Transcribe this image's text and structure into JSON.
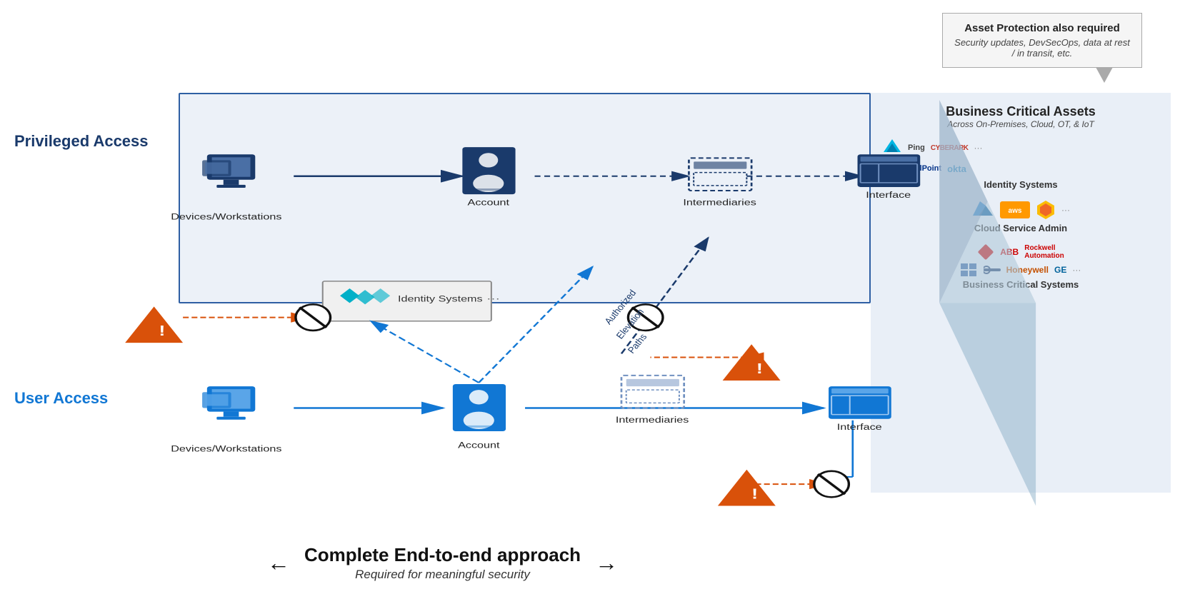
{
  "callout": {
    "title": "Asset Protection also required",
    "body": "Security updates, DevSecOps, data at rest / in transit, etc."
  },
  "labels": {
    "privileged_access": "Privileged Access",
    "user_access": "User Access",
    "bca_title": "Business Critical Assets",
    "bca_subtitle": "Across On-Premises, Cloud, OT, & IoT",
    "identity_systems": "Identity Systems",
    "cloud_service_admin": "Cloud Service Admin",
    "business_critical_systems": "Business Critical Systems",
    "intermediaries": "Intermediaries",
    "account": "Account",
    "interface": "Interface",
    "devices_workstations": "Devices/Workstations",
    "authorized_elevation": "Authorized\nElevation\nPaths",
    "bottom_title": "Complete End-to-end approach",
    "bottom_subtitle": "Required for meaningful security"
  },
  "logos": {
    "identity": [
      "Ping",
      "CYBERARK",
      "SailPoint",
      "okta"
    ],
    "cloud": [
      "aws",
      "GCP"
    ],
    "business": [
      "ABB",
      "Rockwell Automation",
      "Honeywell",
      "GE"
    ]
  },
  "colors": {
    "dark_blue": "#1a3a6b",
    "mid_blue": "#2e5fa3",
    "light_blue": "#1177d4",
    "orange": "#d9510a",
    "gray_border": "#aaa",
    "bg_panel": "#c8d7eb"
  }
}
